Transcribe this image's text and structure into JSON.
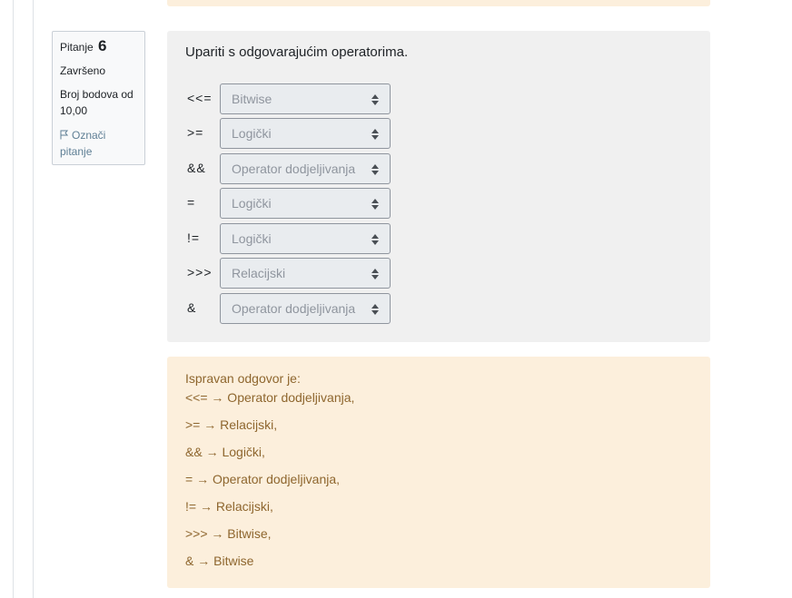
{
  "info": {
    "question_label": "Pitanje",
    "question_number": "6",
    "state": "Završeno",
    "grade": "Broj bodova od 10,00",
    "flag_label": "Označi pitanje",
    "flag_icon": "flag-icon"
  },
  "question": {
    "text": "Upariti s odgovarajućim operatorima.",
    "rows": [
      {
        "stem": "<<=",
        "selected": "Bitwise"
      },
      {
        "stem": ">=",
        "selected": "Logički"
      },
      {
        "stem": "&&",
        "selected": "Operator dodjeljivanja"
      },
      {
        "stem": "=",
        "selected": "Logički"
      },
      {
        "stem": "!=",
        "selected": "Logički"
      },
      {
        "stem": ">>>",
        "selected": "Relacijski"
      },
      {
        "stem": "&",
        "selected": "Operator dodjeljivanja"
      }
    ]
  },
  "feedback": {
    "title": "Ispravan odgovor je:",
    "lines": [
      "<<= → Operator dodjeljivanja,",
      ">= → Relacijski,",
      "&& → Logički,",
      "= → Operator dodjeljivanja,",
      "!= → Relacijski,",
      ">>> → Bitwise,",
      "& → Bitwise"
    ]
  },
  "colors": {
    "feedback_bg": "#fcefdc",
    "feedback_text": "#8e662e",
    "question_bg": "#f0f0f0",
    "link": "#5f7f95"
  }
}
